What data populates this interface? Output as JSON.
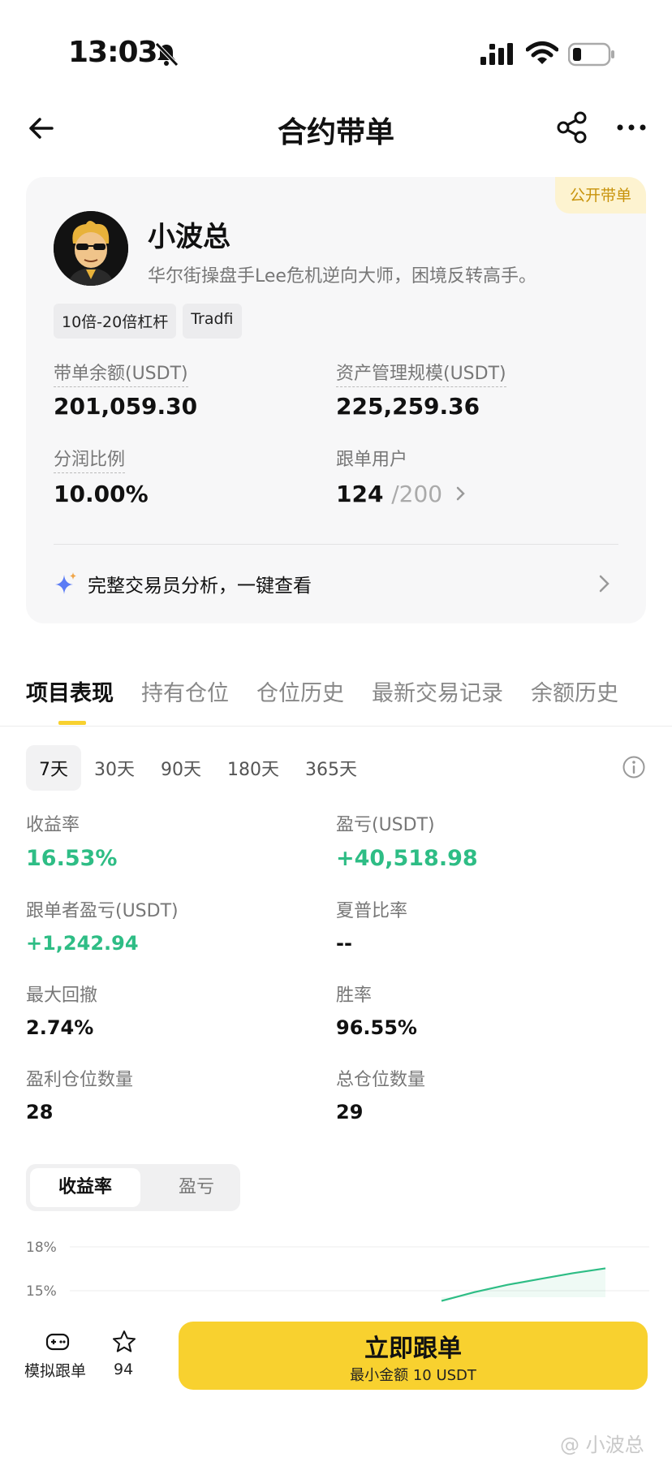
{
  "status_bar": {
    "time": "13:03"
  },
  "nav": {
    "title": "合约带单"
  },
  "profile": {
    "badge": "公开带单",
    "name": "小波总",
    "bio": "华尔街操盘手Lee危机逆向大师，困境反转高手。",
    "tags": [
      "10倍-20倍杠杆",
      "Tradfi"
    ],
    "balance_label": "带单余额(USDT)",
    "balance_value": "201,059.30",
    "aum_label": "资产管理规模(USDT)",
    "aum_value": "225,259.36",
    "share_label": "分润比例",
    "share_value": "10.00%",
    "followers_label": "跟单用户",
    "followers_count": "124",
    "followers_max": "/200",
    "analysis_text": "完整交易员分析，一键查看"
  },
  "tabs": [
    "项目表现",
    "持有仓位",
    "仓位历史",
    "最新交易记录",
    "余额历史"
  ],
  "periods": [
    "7天",
    "30天",
    "90天",
    "180天",
    "365天"
  ],
  "stats": {
    "roi_label": "收益率",
    "roi_value": "16.53%",
    "pnl_label": "盈亏(USDT)",
    "pnl_value": "+40,518.98",
    "follower_pnl_label": "跟单者盈亏(USDT)",
    "follower_pnl_value": "+1,242.94",
    "sharpe_label": "夏普比率",
    "sharpe_value": "--",
    "mdd_label": "最大回撤",
    "mdd_value": "2.74%",
    "winrate_label": "胜率",
    "winrate_value": "96.55%",
    "win_positions_label": "盈利仓位数量",
    "win_positions_value": "28",
    "total_positions_label": "总仓位数量",
    "total_positions_value": "29"
  },
  "segment": {
    "active": "收益率",
    "inactive": "盈亏"
  },
  "chart_data": {
    "type": "area",
    "y_ticks": [
      "18%",
      "15%"
    ],
    "ylim": [
      15,
      18
    ],
    "series": [
      {
        "values": [
          14.3,
          14.9,
          15.4,
          15.8,
          16.2,
          16.53
        ]
      }
    ],
    "color": "#2ebd85"
  },
  "bottom": {
    "sim_label": "模拟跟单",
    "star_count": "94",
    "follow_title": "立即跟单",
    "follow_sub": "最小金额 10 USDT",
    "watermark": "@ 小波总"
  },
  "colors": {
    "accent": "#f8d12f",
    "positive": "#2ebd85",
    "badge_text": "#c8930b"
  }
}
